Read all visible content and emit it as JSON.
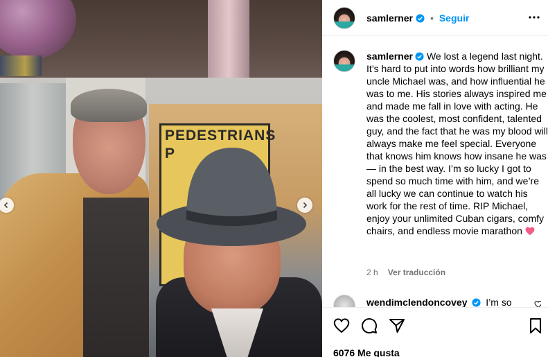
{
  "post": {
    "sign_text": "PEDESTRIANS P",
    "like_count": "6076",
    "likes_label": "Me gusta"
  },
  "header": {
    "username": "samlerner",
    "separator": "•",
    "follow_label": "Seguir"
  },
  "caption": {
    "username": "samlerner",
    "text": "We lost a legend last night. It’s hard to put into words how brilliant my uncle Michael was, and how influential he was to me. His stories always inspired me and made me fall in love with acting. He was the coolest, most confident, talented guy, and the fact that he was my blood will always make me feel special. Everyone that knows him knows how insane he was— in the best way. I’m so lucky I got to spend so much time with him, and we’re all lucky we can continue to watch his work for the rest of time. RIP Michael, enjoy your unlimited Cuban cigars, comfy chairs, and endless movie marathon",
    "time_ago": "2 h",
    "translate_label": "Ver traducción"
  },
  "comment": {
    "username": "wendimclendoncovey",
    "text": "I’m so"
  },
  "colors": {
    "accent": "#0095f6",
    "heart": "#ed4956",
    "muted": "#737373"
  },
  "icons": {
    "like": "heart-outline-icon",
    "comment": "speech-bubble-icon",
    "share": "paper-plane-icon",
    "save": "bookmark-icon",
    "more": "ellipsis-icon",
    "verified": "verified-badge-icon"
  }
}
